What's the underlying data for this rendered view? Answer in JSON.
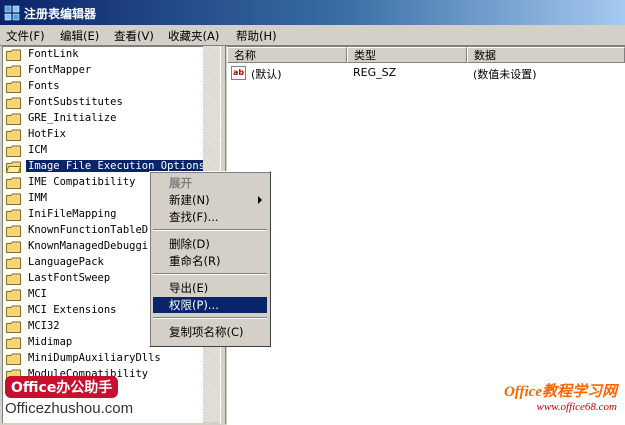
{
  "window": {
    "title": "注册表编辑器"
  },
  "menu": [
    {
      "label": "文件(F)"
    },
    {
      "label": "编辑(E)"
    },
    {
      "label": "查看(V)"
    },
    {
      "label": "收藏夹(A)"
    },
    {
      "label": "帮助(H)"
    }
  ],
  "tree": {
    "items": [
      {
        "label": "FontLink"
      },
      {
        "label": "FontMapper"
      },
      {
        "label": "Fonts"
      },
      {
        "label": "FontSubstitutes"
      },
      {
        "label": "GRE_Initialize"
      },
      {
        "label": "HotFix"
      },
      {
        "label": "ICM"
      },
      {
        "label": "Image File Execution Options"
      },
      {
        "label": "IME Compatibility"
      },
      {
        "label": "IMM"
      },
      {
        "label": "IniFileMapping"
      },
      {
        "label": "KnownFunctionTableDlls"
      },
      {
        "label": "KnownManagedDebuggingDlls"
      },
      {
        "label": "LanguagePack"
      },
      {
        "label": "LastFontSweep"
      },
      {
        "label": "MCI"
      },
      {
        "label": "MCI Extensions"
      },
      {
        "label": "MCI32"
      },
      {
        "label": "Midimap"
      },
      {
        "label": "MiniDumpAuxiliaryDlls"
      },
      {
        "label": "ModuleCompatibility"
      }
    ]
  },
  "list": {
    "columns": [
      {
        "label": "名称"
      },
      {
        "label": "类型"
      },
      {
        "label": "数据"
      }
    ],
    "rows": [
      {
        "name": "(默认)",
        "type": "REG_SZ",
        "data": "(数值未设置)"
      }
    ]
  },
  "context_menu": {
    "items": [
      {
        "label": "展开"
      },
      {
        "label": "新建(N)"
      },
      {
        "label": "查找(F)..."
      },
      {
        "label": "删除(D)"
      },
      {
        "label": "重命名(R)"
      },
      {
        "label": "导出(E)"
      },
      {
        "label": "权限(P)..."
      },
      {
        "label": "复制项名称(C)"
      }
    ]
  },
  "watermarks": {
    "left_badge": "Office办公助手",
    "left_site": "Officezhushou.com",
    "right_brand": "Office教程学习网",
    "right_url": "www.office68.com"
  },
  "colors": {
    "titlebar": "#0a246a",
    "selection": "#0a246a",
    "folder": "#f5d77a"
  }
}
